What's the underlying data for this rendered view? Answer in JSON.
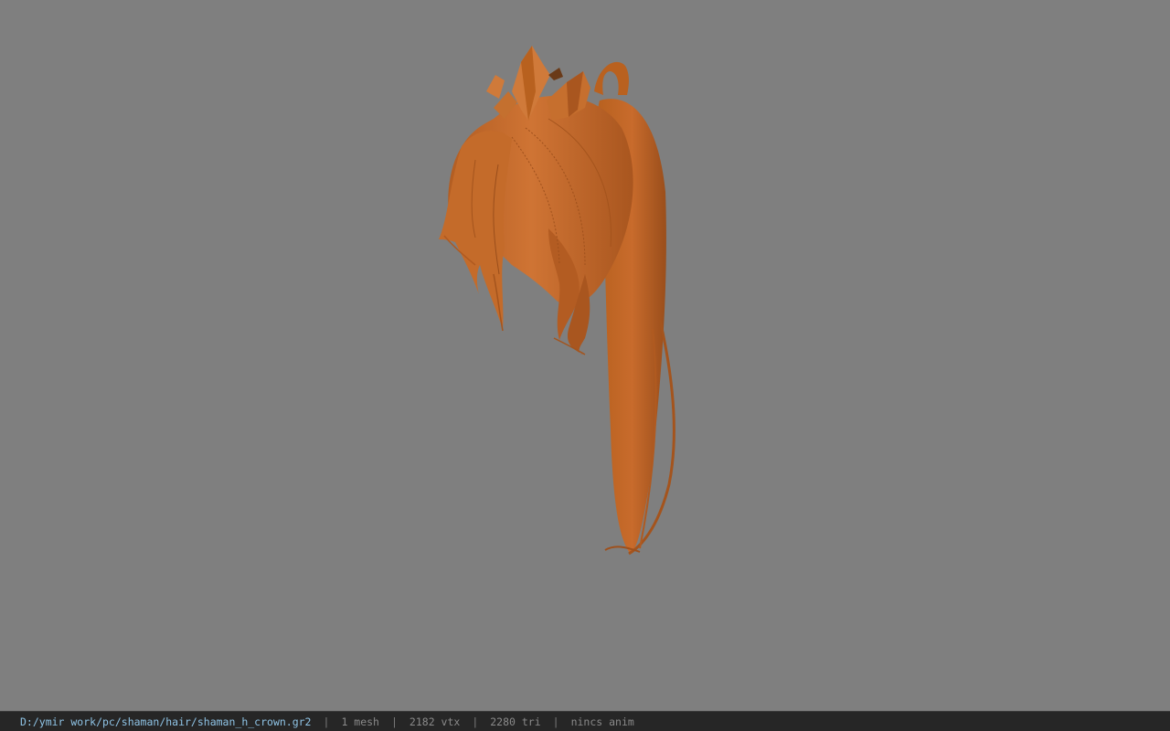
{
  "viewport": {
    "background": "#7f7f7f",
    "model": {
      "name": "hair-model",
      "color": "#c2692d"
    }
  },
  "status_bar": {
    "file_path": "D:/ymir work/pc/shaman/hair/shaman_h_crown.gr2",
    "separator": "|",
    "mesh_count": "1 mesh",
    "vertex_count": "2182 vtx",
    "triangle_count": "2280 tri",
    "anim_status": "nincs anim"
  }
}
